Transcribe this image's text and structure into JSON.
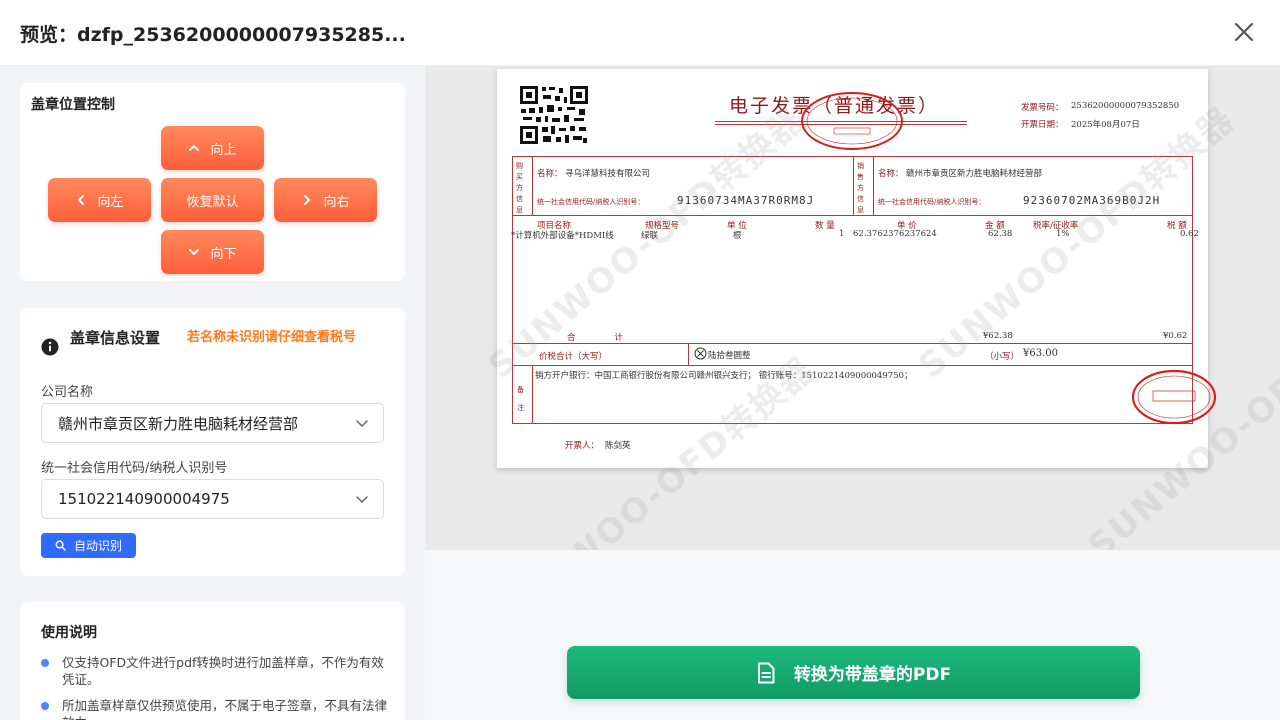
{
  "header": {
    "title": "预览：dzfp_2536200000007935285..."
  },
  "position_control": {
    "title": "盖章位置控制",
    "up": "向上",
    "left": "向左",
    "reset": "恢复默认",
    "right": "向右",
    "down": "向下"
  },
  "stamp_info": {
    "title": "盖章信息设置",
    "hint": "若名称未识别请仔细查看税号",
    "company_label": "公司名称",
    "company_value": "赣州市章贡区新力胜电脑耗材经营部",
    "tax_label": "统一社会信用代码/纳税人识别号",
    "tax_value": "151022140900004975",
    "auto_button": "自动识别"
  },
  "usage": {
    "title": "使用说明",
    "items": [
      "仅支持OFD文件进行pdf转换时进行加盖样章，不作为有效凭证。",
      "所加盖章样章仅供预览使用，不属于电子签章，不具有法律效力。"
    ]
  },
  "invoice": {
    "title": "电子发票（普通发票）",
    "number_label": "发票号码：",
    "number": "25362000000079352850",
    "date_label": "开票日期：",
    "date": "2025年08月07日",
    "buyer_label": "购买方信息",
    "buyer_name_label": "名称：",
    "buyer_name": "寻乌洋慧科技有限公司",
    "buyer_tax_label": "统一社会信用代码/纳税人识别号：",
    "buyer_tax": "91360734MA37R0RM8J",
    "seller_label": "销售方信息",
    "seller_name_label": "名称：",
    "seller_name": "赣州市章贡区新力胜电脑耗材经营部",
    "seller_tax_label": "统一社会信用代码/纳税人识别号：",
    "seller_tax": "92360702MA369B0J2H",
    "col_item": "项目名称",
    "col_spec": "规格型号",
    "col_unit": "单 位",
    "col_qty": "数 量",
    "col_price": "单 价",
    "col_amount": "金 额",
    "col_rate": "税率/征收率",
    "col_tax": "税 额",
    "row_item": "*计算机外部设备*HDMI线",
    "row_spec": "绿联",
    "row_unit": "根",
    "row_qty": "1",
    "row_price": "62.3762376237624",
    "row_amount": "62.38",
    "row_rate": "1%",
    "row_tax": "0.62",
    "total_label": "合 计",
    "total_amount": "¥62.38",
    "total_tax": "¥0.62",
    "grand_label": "价税合计（大写）",
    "grand_upper": "陆拾叁圆整",
    "grand_lower_label": "（小写）",
    "grand_lower": "¥63.00",
    "remark_label": "备注",
    "remark": "销方开户银行：中国工商银行股份有限公司赣州银兴支行；    银行账号：1510221409000049750；",
    "issuer_label": "开票人：",
    "issuer": "陈剑英"
  },
  "watermark_text": "SUNWOO-OFD转换器",
  "convert_button": "转换为带盖章的PDF",
  "colors": {
    "orange_button": "#ff6a42",
    "blue_button": "#2f6bff",
    "green_button": "#15a870",
    "hint": "#ff7a1a",
    "stamp_red": "#d42020"
  }
}
